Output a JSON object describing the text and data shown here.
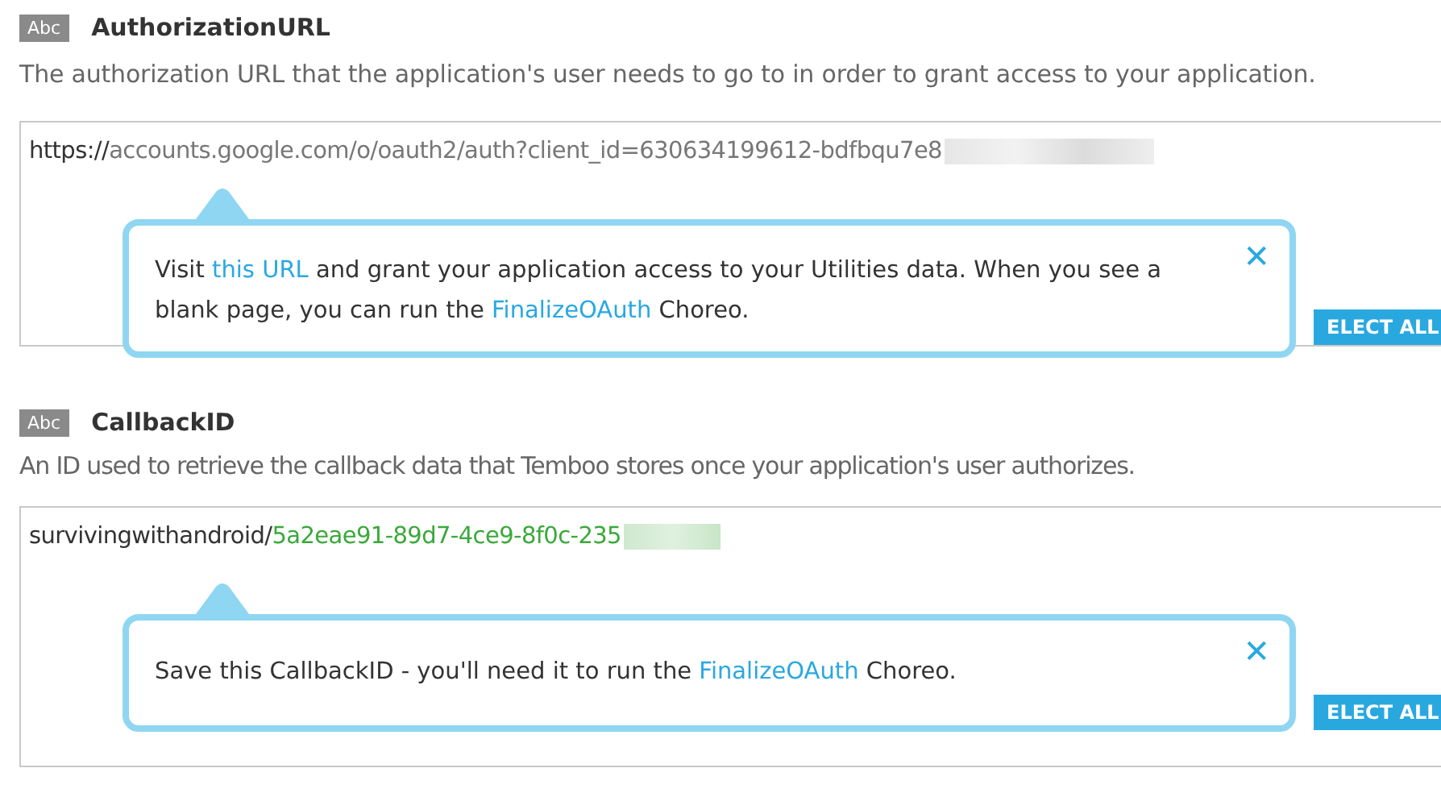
{
  "sections": [
    {
      "badge": "Abc",
      "title": "AuthorizationURL",
      "description": "The authorization URL that the application's user needs to go to in order to grant access to your application.",
      "value": [
        {
          "kind": "plain",
          "text": "https://"
        },
        {
          "kind": "muted",
          "text": "accounts.google.com/o/oauth2/auth?client_id=630634199612-bdfbqu7e8"
        }
      ],
      "redacted": true,
      "button": "ELECT ALL",
      "tooltip": [
        {
          "kind": "plain",
          "text": "Visit "
        },
        {
          "kind": "link",
          "text": "this URL"
        },
        {
          "kind": "plain",
          "text": " and grant your application access to your Utilities data. When you see a blank page, you can run the "
        },
        {
          "kind": "link",
          "text": "FinalizeOAuth"
        },
        {
          "kind": "plain",
          "text": " Choreo."
        }
      ],
      "close": "✕"
    },
    {
      "badge": "Abc",
      "title": "CallbackID",
      "description": "An ID used to retrieve the callback data that Temboo stores once your application's user authorizes.",
      "value": [
        {
          "kind": "plain",
          "text": "survivingwithandroid/"
        },
        {
          "kind": "green",
          "text": "5a2eae91-89d7-4ce9-8f0c-235"
        }
      ],
      "redacted": true,
      "button": "ELECT ALL",
      "tooltip": [
        {
          "kind": "plain",
          "text": "Save this CallbackID - you'll need it to run the "
        },
        {
          "kind": "link",
          "text": "FinalizeOAuth"
        },
        {
          "kind": "plain",
          "text": " Choreo."
        }
      ],
      "close": "✕"
    }
  ]
}
